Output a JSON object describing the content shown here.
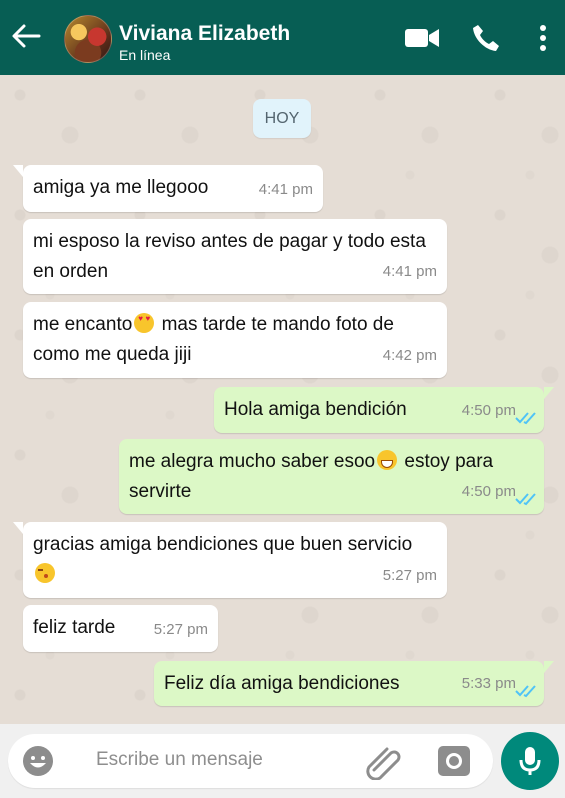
{
  "header": {
    "contact_name": "Viviana Elizabeth",
    "status": "En línea",
    "background_color": "#075e54",
    "icons": [
      "back-arrow-icon",
      "video-call-icon",
      "phone-call-icon",
      "more-vertical-icon"
    ]
  },
  "chat": {
    "day_chip": "HOY",
    "messages": [
      {
        "direction": "incoming",
        "text": "amiga ya me llegooo",
        "time": "4:41 pm"
      },
      {
        "direction": "incoming",
        "text": "mi esposo la reviso antes de pagar y todo esta en orden",
        "time": "4:41 pm"
      },
      {
        "direction": "incoming",
        "text_before": "me encanto",
        "emoji": "heart-eyes-emoji",
        "text_after": " mas tarde te mando foto de como me queda jiji",
        "time": "4:42 pm"
      },
      {
        "direction": "outgoing",
        "text": "Hola amiga bendición",
        "time": "4:50 pm",
        "status": "read"
      },
      {
        "direction": "outgoing",
        "text_before": "me alegra mucho saber esoo",
        "emoji": "grinning-emoji",
        "text_after": " estoy para servirte",
        "time": "4:50 pm",
        "status": "read"
      },
      {
        "direction": "incoming",
        "text_before": "gracias amiga bendiciones que buen servicio ",
        "emoji": "kiss-emoji",
        "text_after": "",
        "time": "5:27 pm"
      },
      {
        "direction": "incoming",
        "text": "feliz tarde",
        "time": "5:27 pm"
      },
      {
        "direction": "outgoing",
        "text": "Feliz día amiga bendiciones",
        "time": "5:33 pm",
        "status": "read"
      }
    ]
  },
  "composer": {
    "placeholder": "Escribe un mensaje",
    "accent_color": "#00897b",
    "icons": [
      "emoji-icon",
      "attachment-icon",
      "camera-icon",
      "microphone-icon"
    ]
  }
}
